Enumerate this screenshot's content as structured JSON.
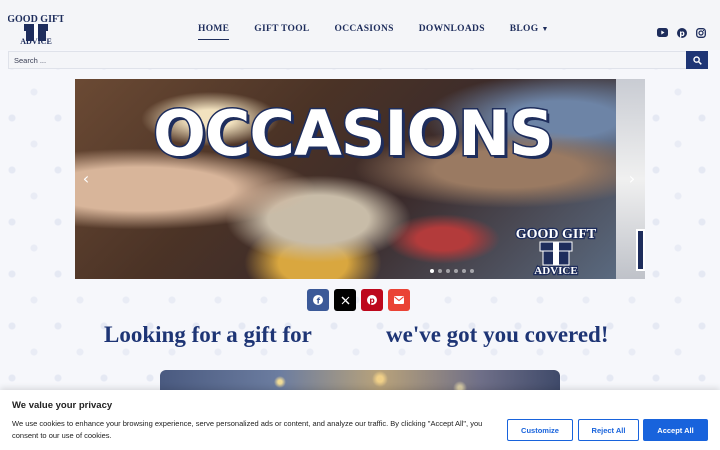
{
  "header": {
    "logo": {
      "line1": "GOOD GIFT",
      "line2": "ADVICE",
      "icon": "gift-box-logo"
    },
    "nav": [
      {
        "label": "HOME",
        "active": true
      },
      {
        "label": "GIFT TOOL"
      },
      {
        "label": "OCCASIONS"
      },
      {
        "label": "DOWNLOADS"
      },
      {
        "label": "BLOG",
        "has_dropdown": true,
        "dropdown_icon": "chevron-down-icon"
      }
    ],
    "social": [
      "youtube-icon",
      "pinterest-icon",
      "instagram-icon"
    ]
  },
  "search": {
    "placeholder": "Search ...",
    "button_icon": "search-icon"
  },
  "slider": {
    "title": "OCCASIONS",
    "logo_line1": "GOOD GIFT",
    "logo_line2": "ADVICE",
    "prev_icon": "chevron-left-icon",
    "next_icon": "chevron-right-icon",
    "dot_count": 6,
    "active_dot": 0
  },
  "share": [
    "facebook-icon",
    "x-icon",
    "pinterest-icon",
    "email-icon"
  ],
  "tagline": {
    "left": "Looking for a gift for",
    "right": "we've got you covered!"
  },
  "cookie": {
    "title": "We value your privacy",
    "text": "We use cookies to enhance your browsing experience, serve personalized ads or content, and analyze our traffic. By clicking \"Accept All\", you consent to our use of cookies.",
    "customize": "Customize",
    "reject": "Reject All",
    "accept": "Accept All"
  },
  "colors": {
    "brand": "#1e3575",
    "accent_blue": "#1863dc"
  }
}
